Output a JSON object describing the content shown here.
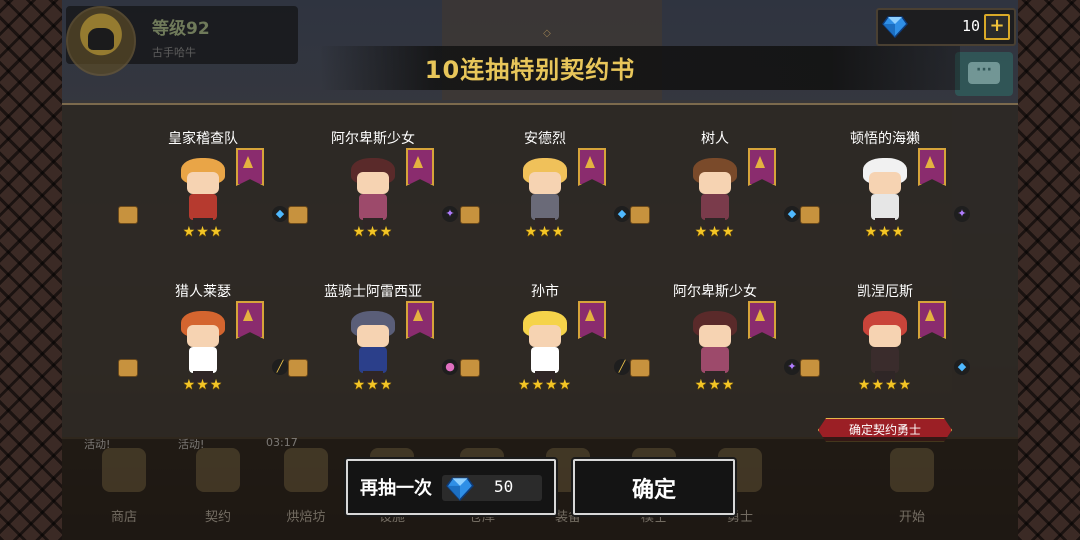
{
  "header": {
    "level": "等级92",
    "player_name": "古手哈牛",
    "gems": "10",
    "plus": "+"
  },
  "title": "10连抽特别契约书",
  "heroes": [
    {
      "name": "皇家稽查队",
      "stars": "★★★",
      "hair": "#e9a547",
      "body": "#b63a2f",
      "type": "blue"
    },
    {
      "name": "阿尔卑斯少女",
      "stars": "★★★",
      "hair": "#5a2a2a",
      "body": "#9d4a6b",
      "type": "purple"
    },
    {
      "name": "安德烈",
      "stars": "★★★",
      "hair": "#f0c15a",
      "body": "#6a6a78",
      "type": "blue"
    },
    {
      "name": "树人",
      "stars": "★★★",
      "hair": "#7a4a2a",
      "body": "#7a3b4b",
      "type": "blue"
    },
    {
      "name": "顿悟的海獭",
      "stars": "★★★",
      "hair": "#f1f1f1",
      "body": "#e6e6e6",
      "type": "purple"
    },
    {
      "name": "猎人莱瑟",
      "stars": "★★★",
      "hair": "#d4652f",
      "body": "#ffffff",
      "type": "gold"
    },
    {
      "name": "蓝骑士阿雷西亚",
      "stars": "★★★",
      "hair": "#5a5e78",
      "body": "#2b3f8a",
      "type": "pink"
    },
    {
      "name": "孙市",
      "stars": "★★★★",
      "hair": "#f5d34a",
      "body": "#ffffff",
      "type": "gold"
    },
    {
      "name": "阿尔卑斯少女",
      "stars": "★★★",
      "hair": "#5a2a2a",
      "body": "#9d4a6b",
      "type": "purple"
    },
    {
      "name": "凯涅厄斯",
      "stars": "★★★★",
      "hair": "#c9443a",
      "body": "#3a2c2c",
      "type": "blue"
    }
  ],
  "confirm_hero_badge": "确定契约勇士",
  "buttons": {
    "redraw_label": "再抽一次",
    "redraw_cost": "50",
    "confirm_label": "确定"
  },
  "nav": [
    {
      "label": "商店",
      "badge": "活动!"
    },
    {
      "label": "契约",
      "badge": "活动!"
    },
    {
      "label": "烘焙坊",
      "badge": "03:17"
    },
    {
      "label": "设施",
      "badge": ""
    },
    {
      "label": "仓库",
      "badge": ""
    },
    {
      "label": "装备",
      "badge": ""
    },
    {
      "label": "模壬",
      "badge": ""
    },
    {
      "label": "勇士",
      "badge": ""
    },
    {
      "label": "开始",
      "badge": ""
    }
  ],
  "colors": {
    "title": "#e8c65a",
    "star": "#f3c526",
    "banner": "#8a2c6e",
    "badge": "#9b1f25"
  }
}
